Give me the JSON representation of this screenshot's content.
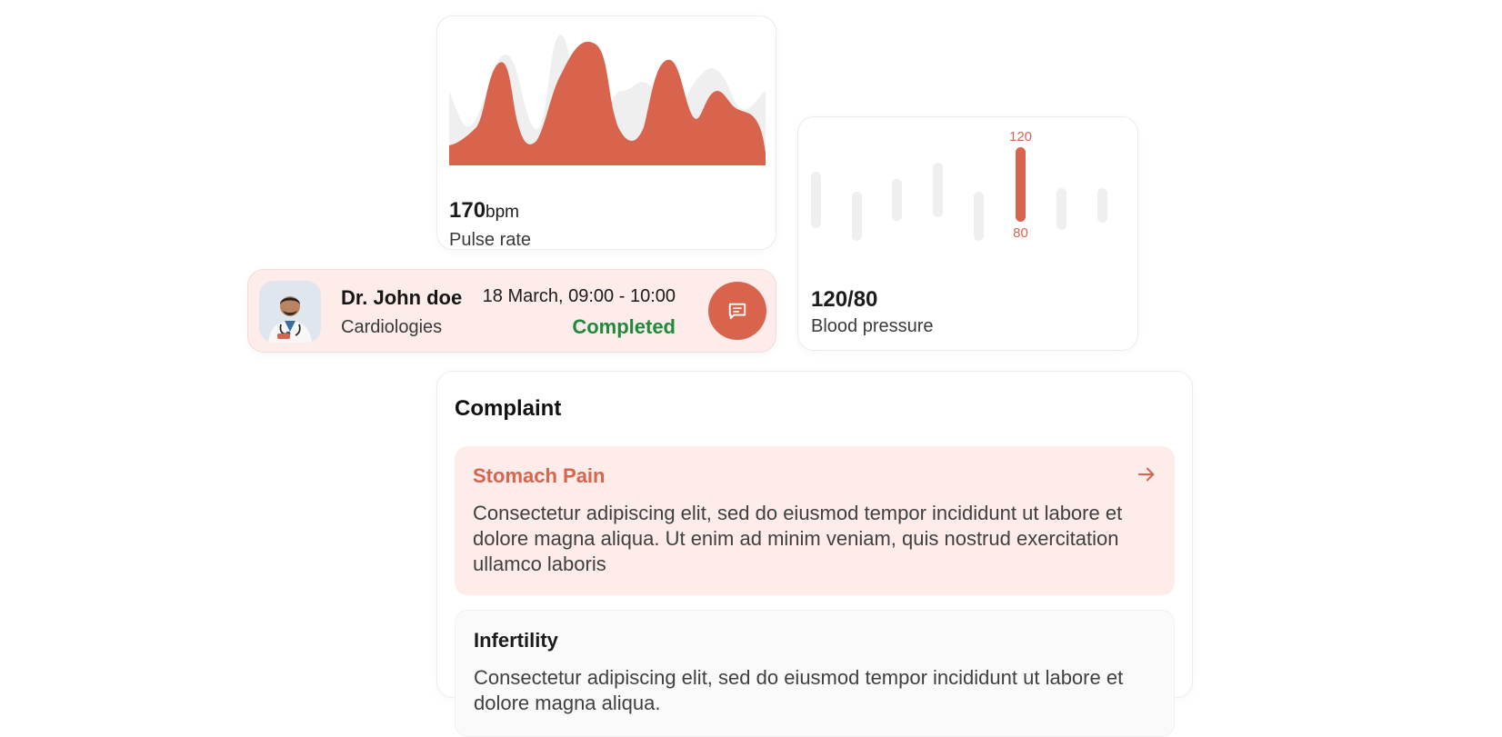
{
  "colors": {
    "accent": "#d8644e",
    "accent_soft": "#fdecea",
    "success": "#1f8a3b",
    "muted": "#f0f0f0"
  },
  "pulse": {
    "value": "170",
    "unit": "bpm",
    "label": "Pulse rate"
  },
  "blood_pressure": {
    "value": "120/80",
    "label": "Blood pressure",
    "highlight_top_label": "120",
    "highlight_bottom_label": "80"
  },
  "appointment": {
    "doctor_name": "Dr. John doe",
    "specialty": "Cardiologies",
    "time": "18 March, 09:00 - 10:00",
    "status": "Completed",
    "chat_icon": "chat-bubble-icon",
    "avatar_icon": "doctor-avatar"
  },
  "complaint": {
    "title": "Complaint",
    "items": [
      {
        "name": "Stomach Pain",
        "description": "Consectetur adipiscing elit, sed do eiusmod tempor incididunt ut labore et dolore magna aliqua. Ut enim ad minim veniam, quis nostrud exercitation ullamco laboris",
        "icon": "arrow-right-icon"
      },
      {
        "name": "Infertility",
        "description": "Consectetur adipiscing elit, sed do eiusmod tempor incididunt ut labore et dolore magna aliqua."
      }
    ]
  }
}
